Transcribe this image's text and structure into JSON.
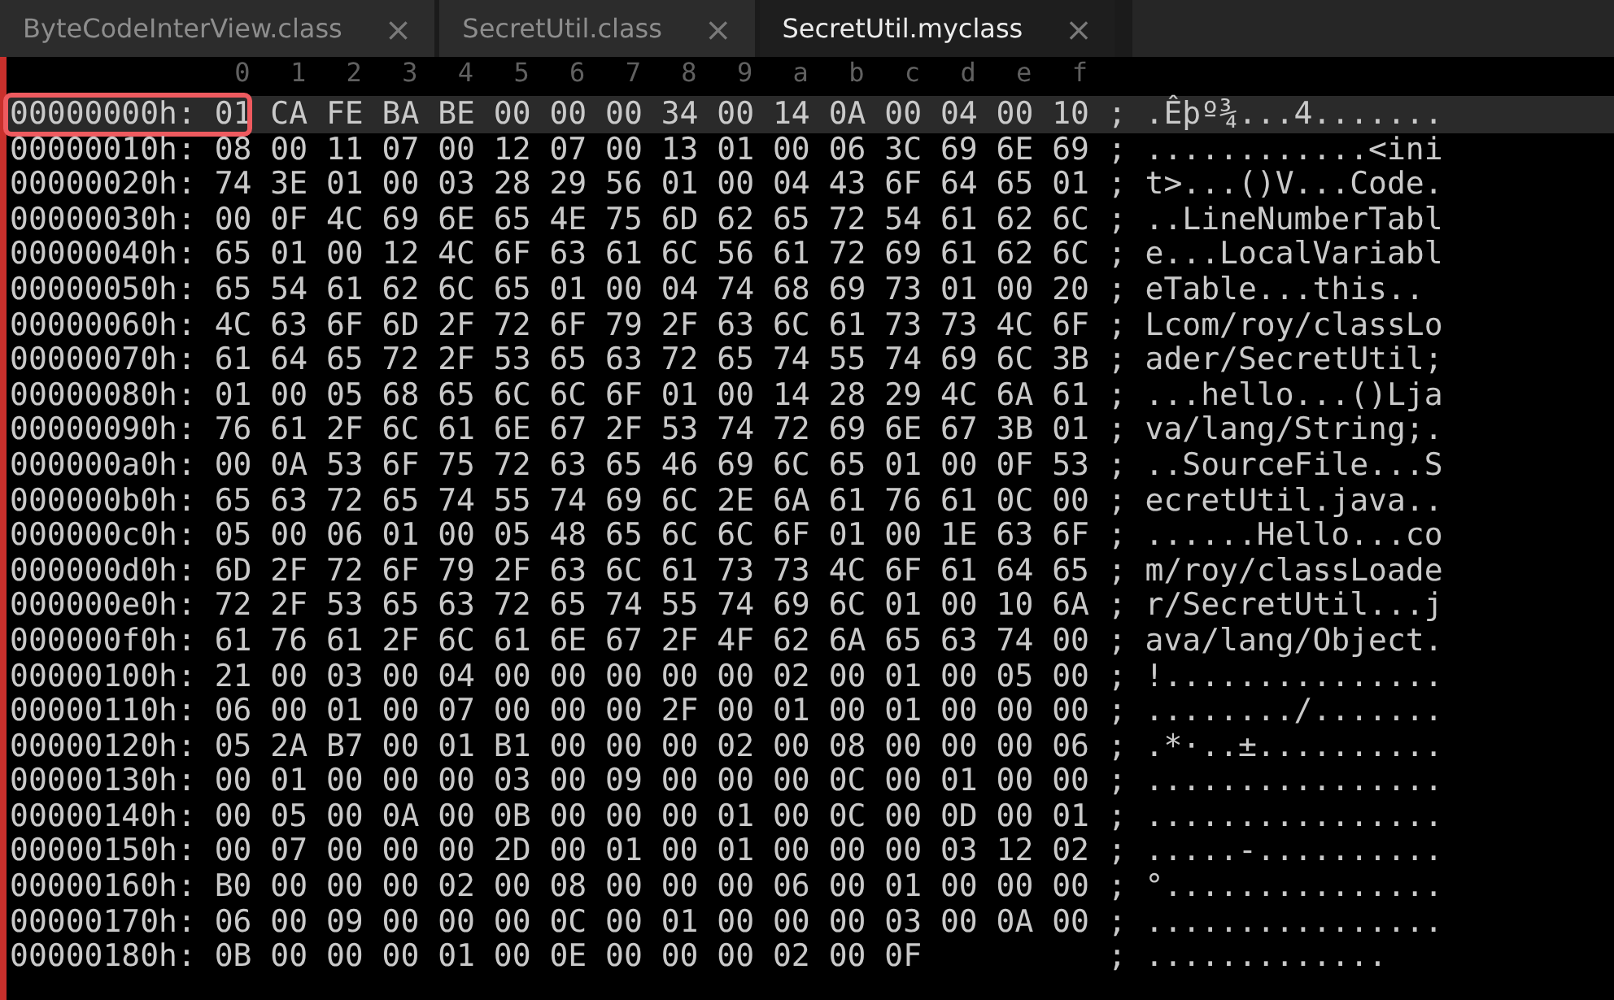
{
  "tabs": [
    {
      "label": "ByteCodeInterView.class",
      "close": "×",
      "selected": false
    },
    {
      "label": "SecretUtil.class",
      "close": "×",
      "selected": false
    },
    {
      "label": "SecretUtil.myclass",
      "close": "×",
      "selected": true
    }
  ],
  "column_headers": [
    "0",
    "1",
    "2",
    "3",
    "4",
    "5",
    "6",
    "7",
    "8",
    "9",
    "a",
    "b",
    "c",
    "d",
    "e",
    "f"
  ],
  "rows": [
    {
      "address": "00000000h:",
      "hex": "01 CA FE BA BE 00 00 00 34 00 14 0A 00 04 00 10",
      "sep": ";",
      "ascii": ".Êþº¾...4.......",
      "selected": true,
      "highlighted": true
    },
    {
      "address": "00000010h:",
      "hex": "08 00 11 07 00 12 07 00 13 01 00 06 3C 69 6E 69",
      "sep": ";",
      "ascii": "............<ini",
      "selected": false,
      "highlighted": false
    },
    {
      "address": "00000020h:",
      "hex": "74 3E 01 00 03 28 29 56 01 00 04 43 6F 64 65 01",
      "sep": ";",
      "ascii": "t>...()V...Code.",
      "selected": false,
      "highlighted": false
    },
    {
      "address": "00000030h:",
      "hex": "00 0F 4C 69 6E 65 4E 75 6D 62 65 72 54 61 62 6C",
      "sep": ";",
      "ascii": "..LineNumberTabl",
      "selected": false,
      "highlighted": false
    },
    {
      "address": "00000040h:",
      "hex": "65 01 00 12 4C 6F 63 61 6C 56 61 72 69 61 62 6C",
      "sep": ";",
      "ascii": "e...LocalVariabl",
      "selected": false,
      "highlighted": false
    },
    {
      "address": "00000050h:",
      "hex": "65 54 61 62 6C 65 01 00 04 74 68 69 73 01 00 20",
      "sep": ";",
      "ascii": "eTable...this..",
      "selected": false,
      "highlighted": false
    },
    {
      "address": "00000060h:",
      "hex": "4C 63 6F 6D 2F 72 6F 79 2F 63 6C 61 73 73 4C 6F",
      "sep": ";",
      "ascii": "Lcom/roy/classLo",
      "selected": false,
      "highlighted": false
    },
    {
      "address": "00000070h:",
      "hex": "61 64 65 72 2F 53 65 63 72 65 74 55 74 69 6C 3B",
      "sep": ";",
      "ascii": "ader/SecretUtil;",
      "selected": false,
      "highlighted": false
    },
    {
      "address": "00000080h:",
      "hex": "01 00 05 68 65 6C 6C 6F 01 00 14 28 29 4C 6A 61",
      "sep": ";",
      "ascii": "...hello...()Lja",
      "selected": false,
      "highlighted": false
    },
    {
      "address": "00000090h:",
      "hex": "76 61 2F 6C 61 6E 67 2F 53 74 72 69 6E 67 3B 01",
      "sep": ";",
      "ascii": "va/lang/String;.",
      "selected": false,
      "highlighted": false
    },
    {
      "address": "000000a0h:",
      "hex": "00 0A 53 6F 75 72 63 65 46 69 6C 65 01 00 0F 53",
      "sep": ";",
      "ascii": "..SourceFile...S",
      "selected": false,
      "highlighted": false
    },
    {
      "address": "000000b0h:",
      "hex": "65 63 72 65 74 55 74 69 6C 2E 6A 61 76 61 0C 00",
      "sep": ";",
      "ascii": "ecretUtil.java..",
      "selected": false,
      "highlighted": false
    },
    {
      "address": "000000c0h:",
      "hex": "05 00 06 01 00 05 48 65 6C 6C 6F 01 00 1E 63 6F",
      "sep": ";",
      "ascii": "......Hello...co",
      "selected": false,
      "highlighted": false
    },
    {
      "address": "000000d0h:",
      "hex": "6D 2F 72 6F 79 2F 63 6C 61 73 73 4C 6F 61 64 65",
      "sep": ";",
      "ascii": "m/roy/classLoade",
      "selected": false,
      "highlighted": false
    },
    {
      "address": "000000e0h:",
      "hex": "72 2F 53 65 63 72 65 74 55 74 69 6C 01 00 10 6A",
      "sep": ";",
      "ascii": "r/SecretUtil...j",
      "selected": false,
      "highlighted": false
    },
    {
      "address": "000000f0h:",
      "hex": "61 76 61 2F 6C 61 6E 67 2F 4F 62 6A 65 63 74 00",
      "sep": ";",
      "ascii": "ava/lang/Object.",
      "selected": false,
      "highlighted": false
    },
    {
      "address": "00000100h:",
      "hex": "21 00 03 00 04 00 00 00 00 00 02 00 01 00 05 00",
      "sep": ";",
      "ascii": "!...............",
      "selected": false,
      "highlighted": false
    },
    {
      "address": "00000110h:",
      "hex": "06 00 01 00 07 00 00 00 2F 00 01 00 01 00 00 00",
      "sep": ";",
      "ascii": "......../.......",
      "selected": false,
      "highlighted": false
    },
    {
      "address": "00000120h:",
      "hex": "05 2A B7 00 01 B1 00 00 00 02 00 08 00 00 00 06",
      "sep": ";",
      "ascii": ".*·..±..........",
      "selected": false,
      "highlighted": false
    },
    {
      "address": "00000130h:",
      "hex": "00 01 00 00 00 03 00 09 00 00 00 0C 00 01 00 00",
      "sep": ";",
      "ascii": "................",
      "selected": false,
      "highlighted": false
    },
    {
      "address": "00000140h:",
      "hex": "00 05 00 0A 00 0B 00 00 00 01 00 0C 00 0D 00 01",
      "sep": ";",
      "ascii": "................",
      "selected": false,
      "highlighted": false
    },
    {
      "address": "00000150h:",
      "hex": "00 07 00 00 00 2D 00 01 00 01 00 00 00 03 12 02",
      "sep": ";",
      "ascii": ".....-..........",
      "selected": false,
      "highlighted": false
    },
    {
      "address": "00000160h:",
      "hex": "B0 00 00 00 02 00 08 00 00 00 06 00 01 00 00 00",
      "sep": ";",
      "ascii": "°...............",
      "selected": false,
      "highlighted": false
    },
    {
      "address": "00000170h:",
      "hex": "06 00 09 00 00 00 0C 00 01 00 00 00 03 00 0A 00",
      "sep": ";",
      "ascii": "................",
      "selected": false,
      "highlighted": false
    },
    {
      "address": "00000180h:",
      "hex": "0B 00 00 00 01 00 0E 00 00 00 02 00 0F",
      "sep": ";",
      "ascii": ".............",
      "selected": false,
      "highlighted": false
    }
  ]
}
